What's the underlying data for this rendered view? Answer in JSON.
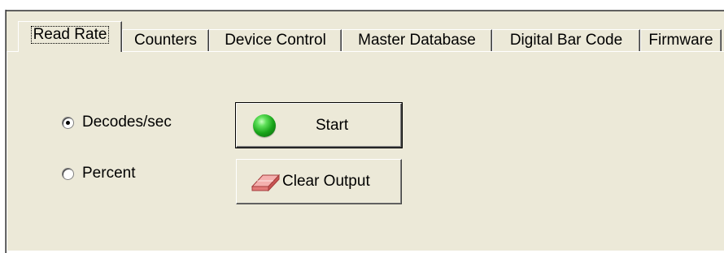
{
  "tabs": [
    {
      "label": "Read Rate",
      "active": true
    },
    {
      "label": "Counters",
      "active": false
    },
    {
      "label": "Device Control",
      "active": false
    },
    {
      "label": "Master Database",
      "active": false
    },
    {
      "label": "Digital Bar Code",
      "active": false
    },
    {
      "label": "Firmware",
      "active": false
    }
  ],
  "read_rate": {
    "radio_decodes": {
      "label": "Decodes/sec",
      "selected": true
    },
    "radio_percent": {
      "label": "Percent",
      "selected": false
    },
    "start_button": {
      "label": "Start",
      "icon": "green-ball-icon"
    },
    "clear_button": {
      "label": "Clear Output",
      "icon": "eraser-icon"
    }
  },
  "colors": {
    "dialog_face": "#ece9d8",
    "start_icon": "#19a51a",
    "eraser_icon": "#e87a7a"
  }
}
